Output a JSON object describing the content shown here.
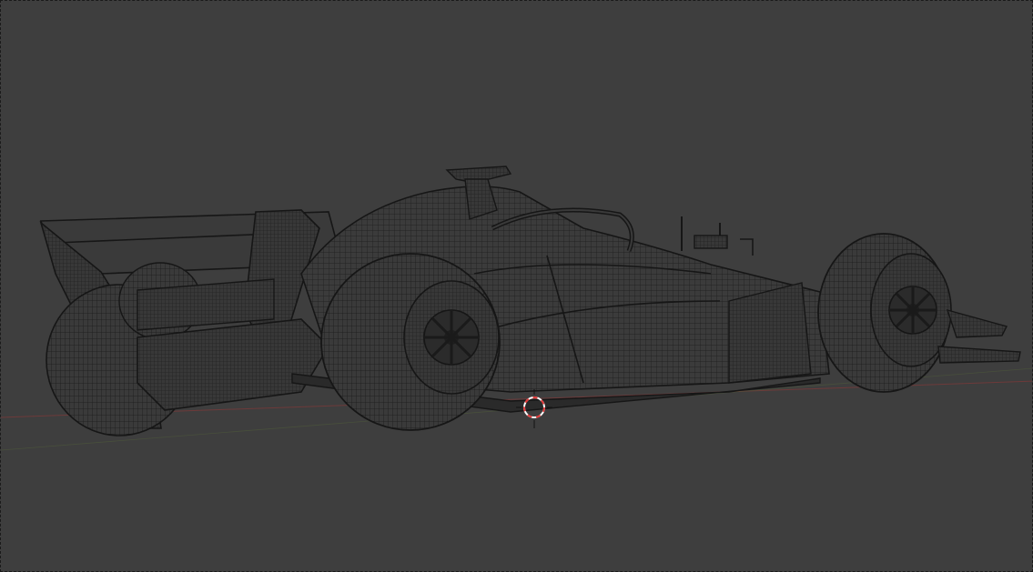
{
  "viewport": {
    "mode": "wireframe",
    "background_color": "#3e3e3e",
    "wire_color": "#161616",
    "x_axis_color": "#7a3b3b",
    "y_axis_color": "#5b6a3a",
    "cursor_color_primary": "#e23a3a",
    "cursor_color_secondary": "#ffffff"
  },
  "scene": {
    "object": "f1-race-car-wireframe",
    "cursor": "3d-cursor-icon"
  }
}
